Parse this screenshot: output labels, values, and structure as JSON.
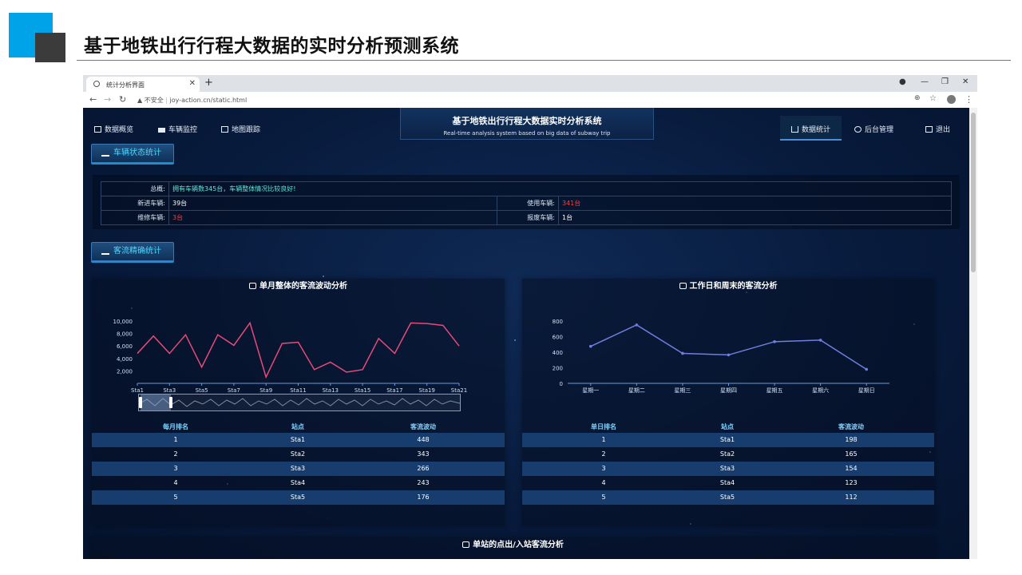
{
  "slide": {
    "title": "基于地铁出行行程大数据的实时分析预测系统"
  },
  "browser": {
    "tab_title": "统计分析界面",
    "url_warning": "不安全",
    "url": "joy-action.cn/static.html"
  },
  "header": {
    "nav_left": [
      "数据概览",
      "车辆监控",
      "地图跟踪"
    ],
    "nav_right": [
      "数据统计",
      "后台管理",
      "退出"
    ],
    "title_cn": "基于地铁出行行程大数据实时分析系统",
    "title_en": "Real-time analysis system based on big data of subway trip"
  },
  "vehicle_section": {
    "label": "车辆状态统计",
    "overview_label": "总概:",
    "overview_text": "拥有车辆数345台，车辆整体情况比较良好!",
    "rows": [
      {
        "l1": "新进车辆:",
        "v1": "39台",
        "l2": "使用车辆:",
        "v2": "341台"
      },
      {
        "l1": "维修车辆:",
        "v1": "3台",
        "l2": "报废车辆:",
        "v2": "1台"
      }
    ],
    "colors": {
      "highlight": "#ff3b3b"
    }
  },
  "flow_section": {
    "label": "客流精确统计"
  },
  "monthly": {
    "title": "单月整体的客流波动分析",
    "table_headers": [
      "每月排名",
      "站点",
      "客流波动"
    ],
    "rows": [
      [
        "1",
        "Sta1",
        "448"
      ],
      [
        "2",
        "Sta2",
        "343"
      ],
      [
        "3",
        "Sta3",
        "266"
      ],
      [
        "4",
        "Sta4",
        "243"
      ],
      [
        "5",
        "Sta5",
        "176"
      ]
    ]
  },
  "weekly": {
    "title": "工作日和周末的客流分析",
    "table_headers": [
      "单日排名",
      "站点",
      "客流波动"
    ],
    "rows": [
      [
        "1",
        "Sta1",
        "198"
      ],
      [
        "2",
        "Sta2",
        "165"
      ],
      [
        "3",
        "Sta3",
        "154"
      ],
      [
        "4",
        "Sta4",
        "123"
      ],
      [
        "5",
        "Sta5",
        "112"
      ]
    ]
  },
  "bottom_panel": {
    "title": "单站的点出/入站客流分析"
  },
  "chart_data": [
    {
      "type": "line",
      "x": [
        "Sta1",
        "Sta2",
        "Sta3",
        "Sta4",
        "Sta5",
        "Sta6",
        "Sta7",
        "Sta8",
        "Sta9",
        "Sta10",
        "Sta11",
        "Sta12",
        "Sta13",
        "Sta14",
        "Sta15",
        "Sta16",
        "Sta17",
        "Sta18",
        "Sta19",
        "Sta20",
        "Sta21"
      ],
      "x_tick_labels": [
        "Sta1",
        "Sta3",
        "Sta5",
        "Sta7",
        "Sta9",
        "Sta11",
        "Sta13",
        "Sta15",
        "Sta17",
        "Sta19",
        "Sta21"
      ],
      "values": [
        4800,
        7600,
        4800,
        7800,
        2600,
        7800,
        6100,
        9700,
        1000,
        6400,
        6600,
        2200,
        3400,
        1800,
        2200,
        7200,
        4800,
        9700,
        9600,
        9300,
        6000
      ],
      "y_tick_labels": [
        "2,000",
        "4,000",
        "6,000",
        "8,000",
        "10,000"
      ],
      "ylim": [
        0,
        10000
      ],
      "color": "#e84a7a",
      "data_zoom": true
    },
    {
      "type": "line",
      "x": [
        "星期一",
        "星期二",
        "星期三",
        "星期四",
        "星期五",
        "星期六",
        "星期日"
      ],
      "values": [
        475,
        750,
        385,
        365,
        535,
        555,
        180
      ],
      "y_tick_labels": [
        "0",
        "200",
        "400",
        "600",
        "800"
      ],
      "ylim": [
        0,
        800
      ],
      "color": "#6f7fe0"
    }
  ]
}
